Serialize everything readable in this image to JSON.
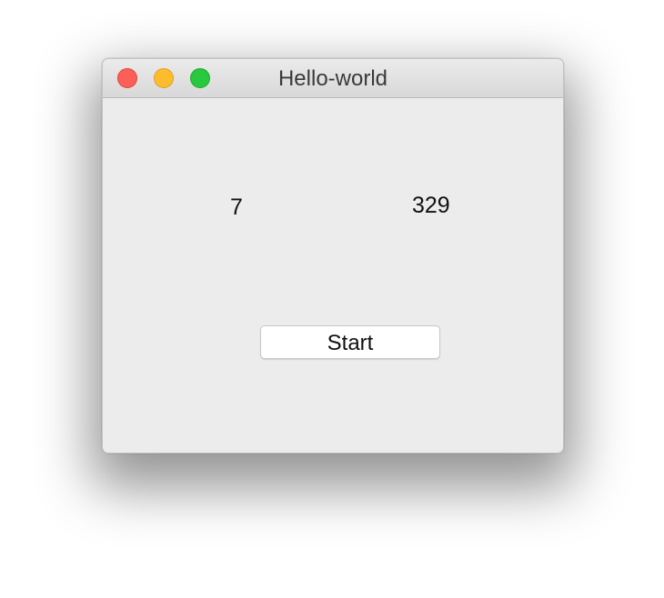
{
  "window": {
    "title": "Hello-world"
  },
  "counters": {
    "left_value": "7",
    "right_value": "329"
  },
  "controls": {
    "start_label": "Start"
  },
  "colors": {
    "close": "#fc5f57",
    "minimize": "#fdbc2e",
    "zoom": "#28c83f",
    "window_background": "#ececec"
  },
  "icons": {
    "close": "close-button-icon",
    "minimize": "minimize-button-icon",
    "zoom": "zoom-button-icon"
  }
}
